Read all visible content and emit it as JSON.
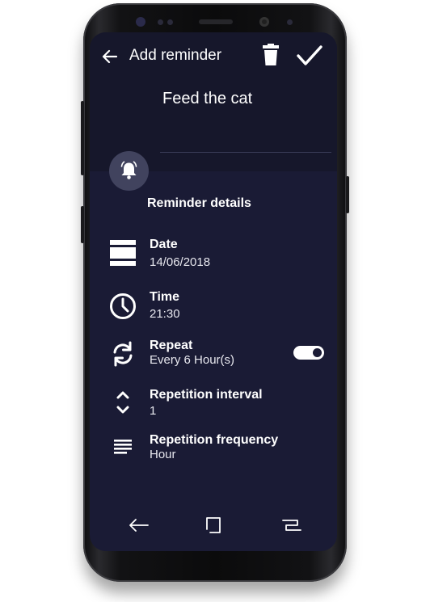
{
  "header": {
    "title": "Add reminder",
    "back_icon": "arrow-left-icon",
    "delete_icon": "trash-icon",
    "confirm_icon": "checkmark-icon"
  },
  "reminder": {
    "name": "Feed the cat"
  },
  "details": {
    "section_title": "Reminder details",
    "date_label": "Date",
    "date_value": "14/06/2018",
    "time_label": "Time",
    "time_value": "21:30",
    "repeat_label": "Repeat",
    "repeat_value": "Every 6 Hour(s)",
    "repeat_enabled": true,
    "interval_label": "Repetition interval",
    "interval_value": "1",
    "frequency_label": "Repetition frequency",
    "frequency_value": "Hour"
  },
  "navbar": {
    "back_icon": "nav-back-icon",
    "home_icon": "nav-home-icon",
    "recents_icon": "nav-recents-icon"
  },
  "colors": {
    "screen_background": "#1a1b35",
    "header_background": "#16172b",
    "bell_circle": "#41435e",
    "text": "#ffffff"
  }
}
